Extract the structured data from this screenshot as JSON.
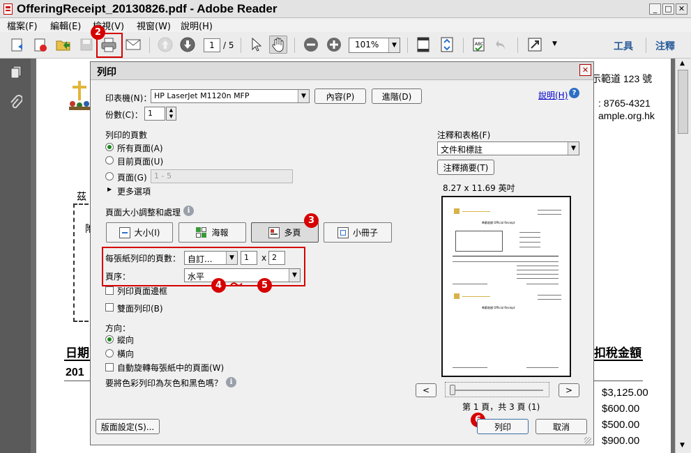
{
  "window": {
    "title": "OfferingReceipt_20130826.pdf - Adobe Reader",
    "icon": "pdf-file-icon",
    "controls": {
      "minimize": "_",
      "maximize": "□",
      "close": "✕"
    }
  },
  "menu": [
    "檔案(F)",
    "編輯(E)",
    "檢視(V)",
    "視窗(W)",
    "說明(H)"
  ],
  "toolbar": {
    "page_current": "1",
    "page_total": "/ 5",
    "zoom": "101%",
    "tools_label": "工具",
    "comment_label": "注釋"
  },
  "callouts": {
    "c2": "2",
    "c3": "3",
    "c4": "4",
    "c5": "5",
    "c6": "6",
    "tilde": "〜"
  },
  "colors": {
    "callout": "#d60000",
    "highlight_box": "#d60000",
    "link": "#0000cc"
  },
  "document": {
    "address": "示範道 123 號",
    "phone": ": 8765-4321",
    "email": "ample.org.hk",
    "left_text_1": "茲",
    "left_text_2": "附",
    "col_date": "日期",
    "col_total": "扣稅金額",
    "row_year": "201",
    "amounts": [
      "$3,125.00",
      "$600.00",
      "$500.00",
      "$900.00"
    ]
  },
  "dialog": {
    "title": "列印",
    "close": "✕",
    "printer_label": "印表機(N)：",
    "printer_value": "HP LaserJet M1120n MFP",
    "properties_btn": "內容(P)",
    "advanced_btn": "進階(D)",
    "help_link": "說明(H)",
    "help_icon": "?",
    "copies_label": "份數(C)：",
    "copies_value": "1",
    "pages_section": "列印的頁數",
    "radio_all": "所有頁面(A)",
    "radio_current": "目前頁面(U)",
    "radio_pages": "頁面(G)",
    "pages_placeholder": "1 - 5",
    "more_options": "更多選項",
    "sizing_section": "頁面大小調整和處理",
    "info_icon": "i",
    "btn_size": "大小(I)",
    "btn_poster": "海報",
    "btn_multiple": "多頁",
    "btn_booklet": "小冊子",
    "pps_label": "每張紙列印的頁數：",
    "pps_value": "自訂...",
    "pps_cols": "1",
    "pps_x": "x",
    "pps_rows": "2",
    "order_label": "頁序：",
    "order_value": "水平",
    "chk_border": "列印頁面邊框",
    "chk_duplex": "雙面列印(B)",
    "orientation_label": "方向：",
    "radio_portrait": "縱向",
    "radio_landscape": "橫向",
    "chk_autorotate": "自動旋轉每張紙中的頁面(W)",
    "grayscale_label": "要將色彩列印為灰色和黑色嗎？",
    "comments_label": "注釋和表格(F)",
    "comments_value": "文件和標註",
    "summarize_btn": "注釋摘要(T)",
    "paper_size": "8.27 x 11.69 英吋",
    "prev_btn": "<",
    "next_btn": ">",
    "page_indicator": "第 1 頁，共 3 頁 (1)",
    "page_setup_btn": "版面設定(S)...",
    "print_btn": "列印",
    "cancel_btn": "取消"
  },
  "preview": {
    "page1_title": "奉獻收據 Official Receipt",
    "page2_title": "奉獻收據 Official Receipt"
  }
}
